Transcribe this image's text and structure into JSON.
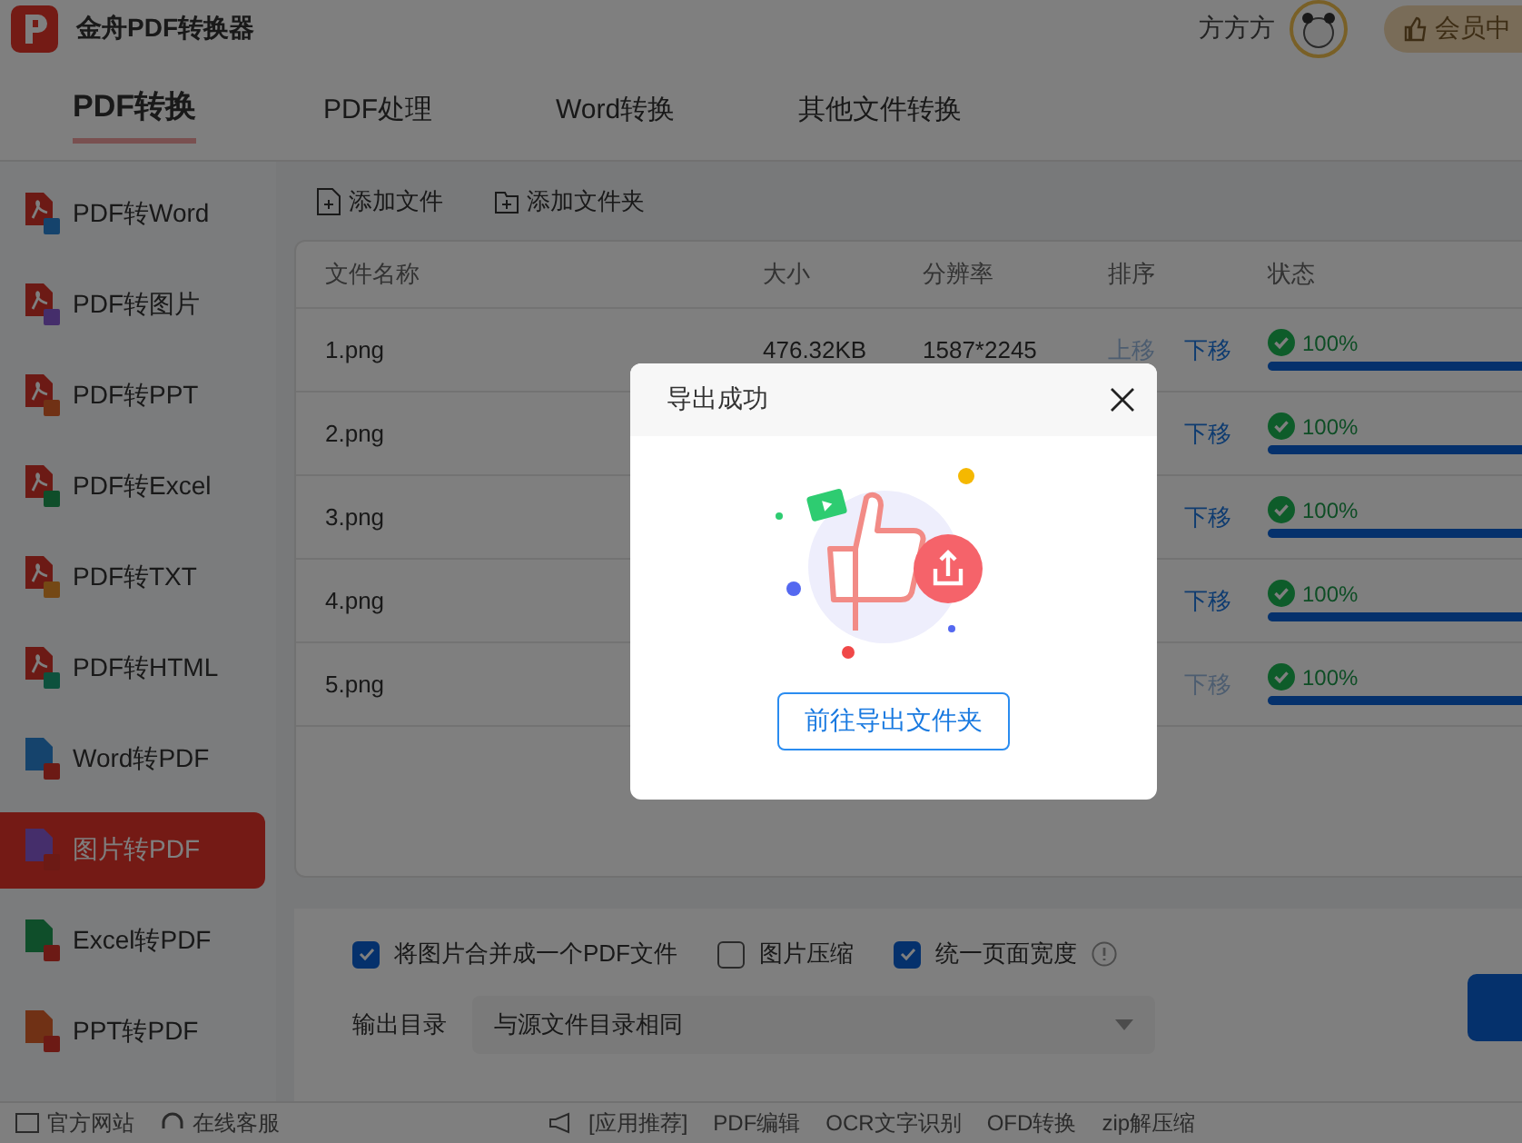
{
  "app": {
    "title": "金舟PDF转换器",
    "user": "方方方",
    "vip": "会员中"
  },
  "tabs": [
    {
      "label": "PDF转换",
      "selected": true
    },
    {
      "label": "PDF处理",
      "selected": false
    },
    {
      "label": "Word转换",
      "selected": false
    },
    {
      "label": "其他文件转换",
      "selected": false
    }
  ],
  "sidebar": {
    "items": [
      {
        "label": "PDF转Word",
        "kind": "pdf-word",
        "selected": false
      },
      {
        "label": "PDF转图片",
        "kind": "pdf-image",
        "selected": false
      },
      {
        "label": "PDF转PPT",
        "kind": "pdf-ppt",
        "selected": false
      },
      {
        "label": "PDF转Excel",
        "kind": "pdf-excel",
        "selected": false
      },
      {
        "label": "PDF转TXT",
        "kind": "pdf-txt",
        "selected": false
      },
      {
        "label": "PDF转HTML",
        "kind": "pdf-html",
        "selected": false
      },
      {
        "label": "Word转PDF",
        "kind": "word-pdf",
        "selected": false
      },
      {
        "label": "图片转PDF",
        "kind": "image-pdf",
        "selected": true
      },
      {
        "label": "Excel转PDF",
        "kind": "excel-pdf",
        "selected": false
      },
      {
        "label": "PPT转PDF",
        "kind": "ppt-pdf",
        "selected": false
      }
    ]
  },
  "toolbar": [
    {
      "label": "添加文件",
      "kind": "file"
    },
    {
      "label": "添加文件夹",
      "kind": "folder"
    }
  ],
  "table": {
    "columns": [
      "文件名称",
      "大小",
      "分辨率",
      "排序",
      "状态"
    ],
    "rows": [
      {
        "name": "1.png",
        "size": "476.32KB",
        "resolution": "1587*2245",
        "up": "上移",
        "up_disabled": true,
        "down": "下移",
        "down_disabled": false,
        "status": "100%",
        "level": 1
      },
      {
        "name": "2.png",
        "down": "下移",
        "down_disabled": false,
        "status": "100%",
        "level": 1
      },
      {
        "name": "3.png",
        "down": "下移",
        "down_disabled": false,
        "status": "100%",
        "level": 1
      },
      {
        "name": "4.png",
        "down": "下移",
        "down_disabled": false,
        "status": "100%",
        "level": 1
      },
      {
        "name": "5.png",
        "down": "下移",
        "down_disabled": true,
        "status": "100%",
        "level": 1
      }
    ]
  },
  "options": [
    {
      "label": "将图片合并成一个PDF文件",
      "checked": true
    },
    {
      "label": "图片压缩",
      "checked": false
    },
    {
      "label": "统一页面宽度",
      "checked": true,
      "info": true
    }
  ],
  "output": {
    "label": "输出目录",
    "value": "与源文件目录相同"
  },
  "footer": {
    "links": [
      {
        "label": "官方网站",
        "kind": "web"
      },
      {
        "label": "在线客服",
        "kind": "service"
      }
    ],
    "promo": "[应用推荐]",
    "tools": [
      "PDF编辑",
      "OCR文字识别",
      "OFD转换",
      "zip解压缩"
    ]
  },
  "dialog": {
    "title": "导出成功",
    "button": "前往导出文件夹"
  }
}
